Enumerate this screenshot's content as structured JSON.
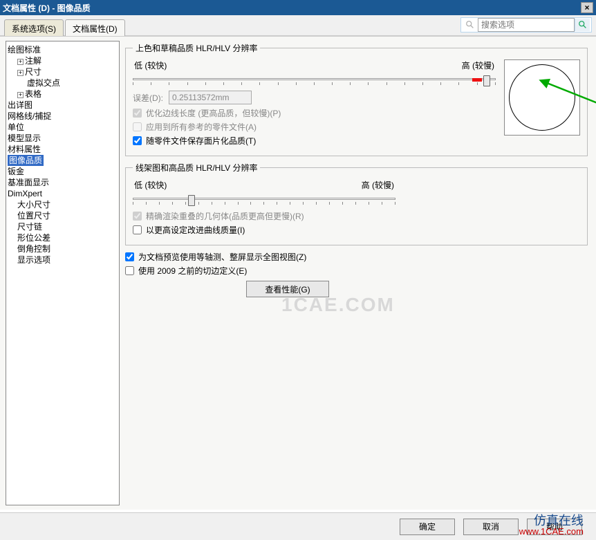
{
  "title": "文档属性 (D)  -  图像品质",
  "tabs": {
    "systemOptions": "系统选项(S)",
    "documentProps": "文档属性(D)"
  },
  "search": {
    "placeholder": "搜索选项"
  },
  "tree": {
    "root": "绘图标准",
    "annotations": "注解",
    "dimensions": "尺寸",
    "virtualSharps": "虚拟交点",
    "tables": "表格",
    "detailing": "出详图",
    "gridSnap": "网格线/捕捉",
    "units": "单位",
    "modelDisplay": "模型显示",
    "materialProps": "材料属性",
    "imageQuality": "图像品质",
    "sheetMetal": "钣金",
    "planeDisplay": "基准面显示",
    "dimXpert": "DimXpert",
    "sizeDim": "大小尺寸",
    "locDim": "位置尺寸",
    "chainDim": "尺寸链",
    "geoTol": "形位公差",
    "chamferCtrl": "倒角控制",
    "dispOptions": "显示选项"
  },
  "fs1": {
    "legend": "上色和草稿品质 HLR/HLV 分辨率",
    "low": "低 (较快)",
    "high": "高 (较慢)",
    "deviationLabel": "误差(D):",
    "deviationValue": "0.25113572mm",
    "optEdge": "优化边线长度 (更高品质，但较慢)(P)",
    "applyAll": "应用到所有参考的零件文件(A)",
    "saveTess": "随零件文件保存面片化品质(T)"
  },
  "fs2": {
    "legend": "线架图和高品质 HLR/HLV 分辨率",
    "low": "低 (较快)",
    "high": "高 (较慢)",
    "precise": "精确渲染重叠的几何体(品质更高但更慢)(R)",
    "improve": "以更高设定改进曲线质量(I)"
  },
  "iso": "为文档预览使用等轴测、整屏显示全图视图(Z)",
  "pre2009": "使用 2009 之前的切边定义(E)",
  "viewPerf": "查看性能(G)",
  "buttons": {
    "ok": "确定",
    "cancel": "取消",
    "help": "帮助"
  },
  "watermark": {
    "line1": "仿真在线",
    "line2": "www.1CAE.com",
    "center": "1CAE.COM"
  }
}
